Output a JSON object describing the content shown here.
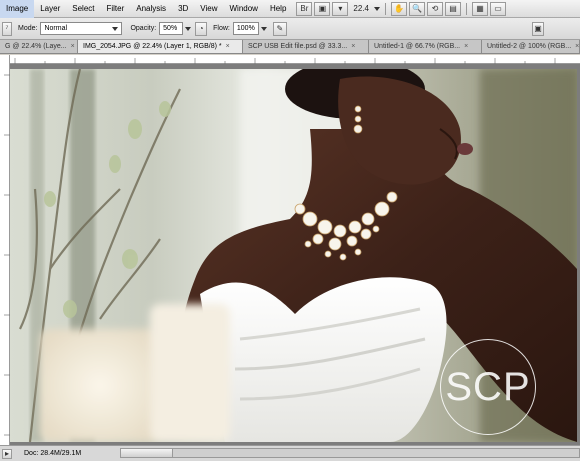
{
  "menubar": {
    "items": [
      "Image",
      "Layer",
      "Select",
      "Filter",
      "Analysis",
      "3D",
      "View",
      "Window",
      "Help"
    ],
    "zoom": "22.4"
  },
  "options": {
    "mode_label": "Mode:",
    "mode_value": "Normal",
    "opacity_label": "Opacity:",
    "opacity_value": "50%",
    "flow_label": "Flow:",
    "flow_value": "100%"
  },
  "tabs": [
    {
      "label": "G @ 22.4% (Laye...",
      "active": false
    },
    {
      "label": "IMG_2054.JPG @ 22.4% (Layer 1, RGB/8) *",
      "active": true
    },
    {
      "label": "SCP USB Edit file.psd @ 33.3...",
      "active": false
    },
    {
      "label": "Untitled-1 @ 66.7% (RGB...",
      "active": false
    },
    {
      "label": "Untitled-2 @ 100% (RGB...",
      "active": false
    }
  ],
  "watermark": "SCP",
  "status": {
    "doc": "Doc: 28.4M/29.1M"
  }
}
